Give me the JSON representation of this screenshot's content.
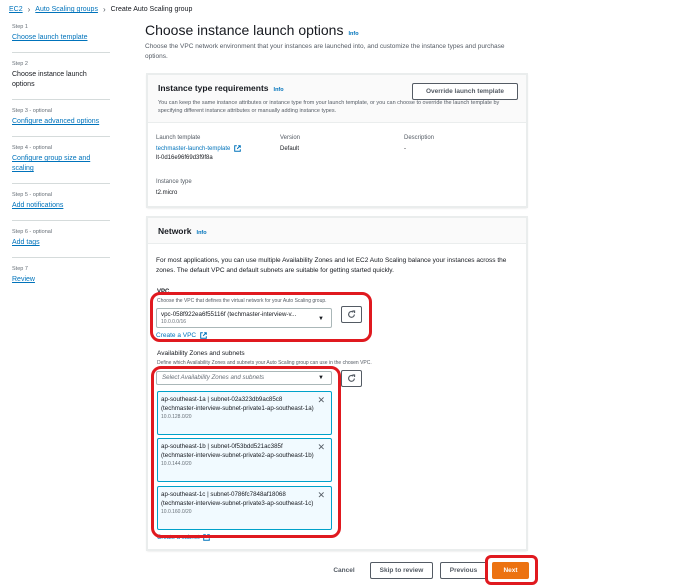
{
  "breadcrumb": {
    "items": [
      "EC2",
      "Auto Scaling groups"
    ],
    "current": "Create Auto Scaling group"
  },
  "steps": [
    {
      "num": "Step 1",
      "title": "Choose launch template",
      "active": false
    },
    {
      "num": "Step 2",
      "title": "Choose instance launch options",
      "active": true
    },
    {
      "num": "Step 3 - optional",
      "title": "Configure advanced options",
      "active": false
    },
    {
      "num": "Step 4 - optional",
      "title": "Configure group size and scaling",
      "active": false
    },
    {
      "num": "Step 5 - optional",
      "title": "Add notifications",
      "active": false
    },
    {
      "num": "Step 6 - optional",
      "title": "Add tags",
      "active": false
    },
    {
      "num": "Step 7",
      "title": "Review",
      "active": false
    }
  ],
  "page": {
    "title": "Choose instance launch options",
    "info": "Info",
    "description": "Choose the VPC network environment that your instances are launched into, and customize the instance types and purchase options."
  },
  "instance_type": {
    "title": "Instance type requirements",
    "info": "Info",
    "override_label": "Override launch template",
    "description": "You can keep the same instance attributes or instance type from your launch template, or you can choose to override the launch template by specifying different instance attributes or manually adding instance types.",
    "launch_template_label": "Launch template",
    "launch_template_value": "techmaster-launch-template",
    "launch_template_id": "lt-0d16e96f69d3f9f8a",
    "version_label": "Version",
    "version_value": "Default",
    "description_label": "Description",
    "description_value": "-",
    "instance_type_label": "Instance type",
    "instance_type_value": "t2.micro"
  },
  "network": {
    "title": "Network",
    "info": "Info",
    "description": "For most applications, you can use multiple Availability Zones and let EC2 Auto Scaling balance your instances across the zones. The default VPC and default subnets are suitable for getting started quickly.",
    "vpc_label": "VPC",
    "vpc_hint": "Choose the VPC that defines the virtual network for your Auto Scaling group.",
    "vpc_value": "vpc-058f922ea6f55116f (techmaster-interview-v...",
    "vpc_cidr": "10.0.0.0/16",
    "create_vpc": "Create a VPC",
    "az_label": "Availability Zones and subnets",
    "az_hint": "Define which Availability Zones and subnets your Auto Scaling group can use in the chosen VPC.",
    "az_placeholder": "Select Availability Zones and subnets",
    "subnets": [
      {
        "name": "ap-southeast-1a | subnet-02a323db9ac85c8 (techmaster-interview-subnet-private1-ap-southeast-1a)",
        "cidr": "10.0.128.0/20"
      },
      {
        "name": "ap-southeast-1b | subnet-0f53bdd521ac385f (techmaster-interview-subnet-private2-ap-southeast-1b)",
        "cidr": "10.0.144.0/20"
      },
      {
        "name": "ap-southeast-1c | subnet-0786fc7848af18068 (techmaster-interview-subnet-private3-ap-southeast-1c)",
        "cidr": "10.0.160.0/20"
      }
    ],
    "create_subnet": "Create a subnet"
  },
  "footer": {
    "cancel": "Cancel",
    "skip": "Skip to review",
    "previous": "Previous",
    "next": "Next"
  },
  "colors": {
    "link": "#0073bb",
    "primary": "#ec7211",
    "highlight": "#e0191f",
    "token_bg": "#f1faff",
    "token_border": "#00a1c9"
  }
}
